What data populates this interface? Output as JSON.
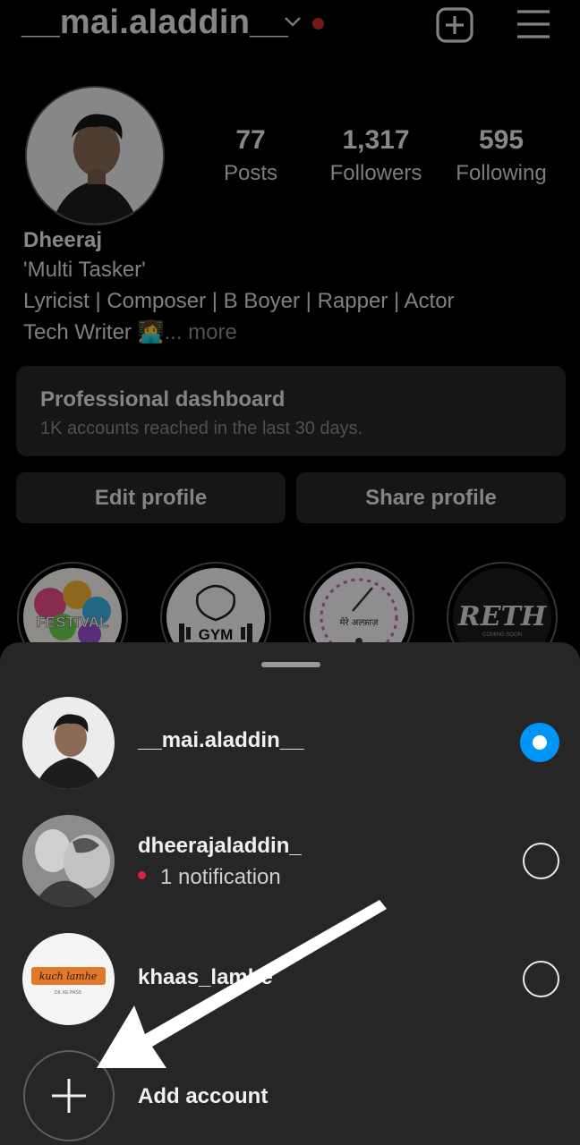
{
  "header": {
    "username": "__mai.aladdin__",
    "has_notification_dot": true
  },
  "stats": [
    {
      "value": "77",
      "label": "Posts"
    },
    {
      "value": "1,317",
      "label": "Followers"
    },
    {
      "value": "595",
      "label": "Following"
    }
  ],
  "bio": {
    "name": "Dheeraj",
    "line1": "'Multi Tasker'",
    "line2": "Lyricist  | Composer | B Boyer | Rapper | Actor",
    "line3": "Tech Writer 👩‍💻",
    "more": "... more"
  },
  "dashboard": {
    "title": "Professional dashboard",
    "subtitle": "1K accounts reached in the last 30 days."
  },
  "buttons": {
    "edit": "Edit profile",
    "share": "Share profile"
  },
  "highlights": [
    {
      "text": "FESTIVAL"
    },
    {
      "text": "GYM"
    },
    {
      "text": "मेरे अल्फ़ाज़"
    },
    {
      "text": "RETH",
      "subtext": "COMING SOON"
    }
  ],
  "sheet": {
    "accounts": [
      {
        "name": "__mai.aladdin__",
        "notification": "",
        "selected": true
      },
      {
        "name": "dheerajaladdin_",
        "notification": "1 notification",
        "selected": false
      },
      {
        "name": "khaas_lamhe",
        "notification": "",
        "selected": false,
        "avatar_text": "kuch lamhe",
        "avatar_subtext": "DIL KE PASS"
      }
    ],
    "add_account": "Add account"
  },
  "colors": {
    "background": "#000000",
    "card": "#262626",
    "accent": "#0095f6",
    "notification": "#e0203d"
  }
}
